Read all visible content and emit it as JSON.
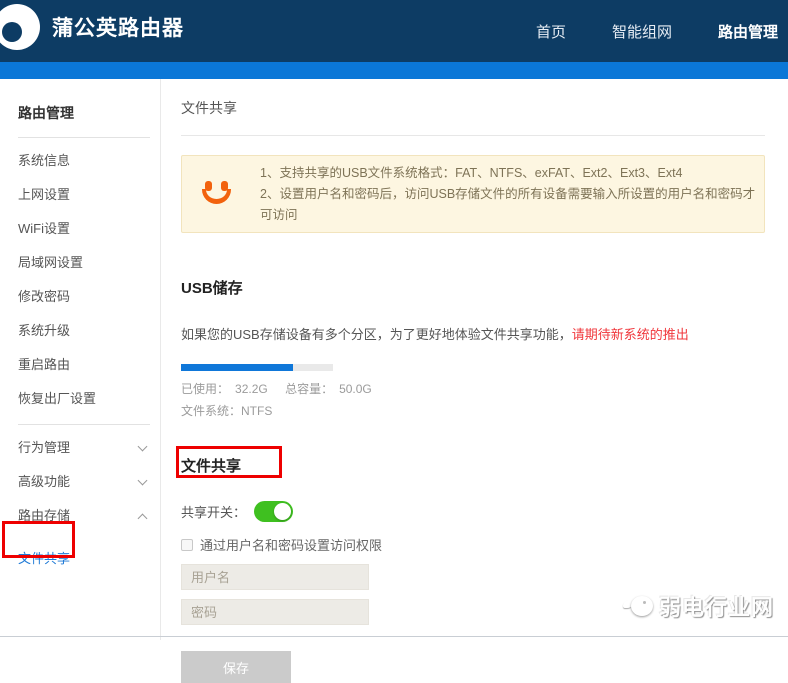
{
  "header": {
    "brand": "蒲公英路由器",
    "nav": [
      {
        "label": "首页"
      },
      {
        "label": "智能组网"
      },
      {
        "label": "路由管理",
        "active": true
      }
    ]
  },
  "sidebar": {
    "section_title": "路由管理",
    "items": [
      "系统信息",
      "上网设置",
      "WiFi设置",
      "局域网设置",
      "修改密码",
      "系统升级",
      "重启路由",
      "恢复出厂设置"
    ],
    "groups": [
      {
        "label": "行为管理",
        "state": "collapsed"
      },
      {
        "label": "高级功能",
        "state": "collapsed"
      },
      {
        "label": "路由存储",
        "state": "expanded"
      }
    ],
    "active_item": "文件共享"
  },
  "main": {
    "title": "文件共享",
    "notice": {
      "line1": "1、支持共享的USB文件系统格式：FAT、NTFS、exFAT、Ext2、Ext3、Ext4",
      "line2": "2、设置用户名和密码后，访问USB存储文件的所有设备需要输入所设置的用户名和密码才可访问"
    },
    "usb": {
      "heading": "USB储存",
      "desc": "如果您的USB存储设备有多个分区，为了更好地体验文件共享功能，",
      "desc_highlight": "请期待新系统的推出",
      "progress_percent": 74,
      "used_label": "已使用：",
      "used_value": "32.2G",
      "total_label": "总容量：",
      "total_value": "50.0G",
      "fs_label": "文件系统：",
      "fs_value": "NTFS"
    },
    "share": {
      "heading": "文件共享",
      "switch_label": "共享开关：",
      "switch_on": true,
      "checkbox_label": "通过用户名和密码设置访问权限",
      "checkbox_checked": false,
      "username_placeholder": "用户名",
      "password_placeholder": "密码",
      "save_label": "保存"
    }
  },
  "watermark": {
    "text": "弱电行业网"
  },
  "colors": {
    "header_bg": "#0d3c64",
    "accent_blue": "#0b77d7",
    "notice_bg": "#fdf6e1",
    "toggle_green": "#3fc020",
    "alert_red": "#f0373c",
    "annotation_red": "#ee0000"
  }
}
